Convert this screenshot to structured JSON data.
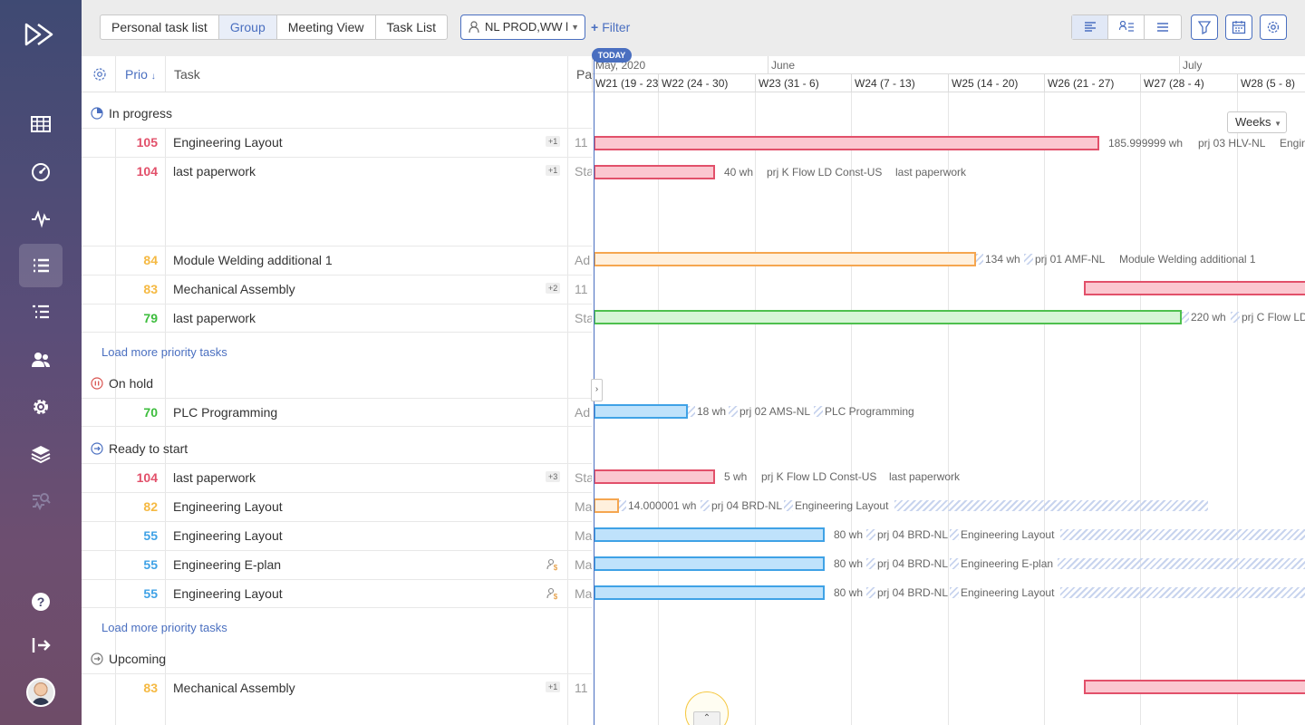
{
  "nav": {
    "items": [
      "dashboard",
      "overview",
      "activity",
      "task-list",
      "hierarchy",
      "users",
      "settings",
      "layers",
      "analytics",
      "help",
      "logout"
    ]
  },
  "toolbar": {
    "view_tabs": [
      "Personal task list",
      "Group",
      "Meeting View",
      "Task List"
    ],
    "active_view": "Group",
    "group_value": "NL PROD,WW l",
    "filter_label": "Filter"
  },
  "table": {
    "col_prio": "Prio",
    "col_task": "Task",
    "col_pa": "Pa",
    "load_more": "Load more priority tasks",
    "groups": [
      {
        "name": "In progress",
        "rows": [
          {
            "prio": "105",
            "color": "#e2506a",
            "task": "Engineering Layout",
            "badge": "+1",
            "pa": "11"
          },
          {
            "prio": "104",
            "color": "#e2506a",
            "task": "last paperwork",
            "badge": "+1",
            "pa": "Sta"
          },
          {
            "prio": "84",
            "color": "#f5b942",
            "task": "Module Welding additional 1",
            "badge": "",
            "pa": "Ad"
          },
          {
            "prio": "83",
            "color": "#f5b942",
            "task": "Mechanical Assembly",
            "badge": "+2",
            "pa": "11"
          },
          {
            "prio": "79",
            "color": "#3dbd3d",
            "task": "last paperwork",
            "badge": "",
            "pa": "Sta"
          }
        ]
      },
      {
        "name": "On hold",
        "rows": [
          {
            "prio": "70",
            "color": "#3dbd3d",
            "task": "PLC Programming",
            "badge": "",
            "pa": "Ad"
          }
        ]
      },
      {
        "name": "Ready to start",
        "rows": [
          {
            "prio": "104",
            "color": "#e2506a",
            "task": "last paperwork",
            "badge": "+3",
            "pa": "Sta"
          },
          {
            "prio": "82",
            "color": "#f5b942",
            "task": "Engineering Layout",
            "badge": "",
            "pa": "Ma"
          },
          {
            "prio": "55",
            "color": "#3fa2e6",
            "task": "Engineering Layout",
            "badge": "",
            "pa": "Ma"
          },
          {
            "prio": "55",
            "color": "#3fa2e6",
            "task": "Engineering E-plan",
            "badge": "",
            "pa": "Ma"
          },
          {
            "prio": "55",
            "color": "#3fa2e6",
            "task": "Engineering Layout",
            "badge": "",
            "pa": "Ma"
          }
        ]
      },
      {
        "name": "Upcoming",
        "rows": [
          {
            "prio": "83",
            "color": "#f5b942",
            "task": "Mechanical Assembly",
            "badge": "+1",
            "pa": "11"
          }
        ]
      }
    ]
  },
  "gantt": {
    "today": "TODAY",
    "zoom": "Weeks",
    "months": [
      "May, 2020",
      "June",
      "July"
    ],
    "weeks": [
      "W21 (19 - 23",
      "W22 (24 - 30)",
      "W23 (31 - 6)",
      "W24 (7 - 13)",
      "W25 (14 - 20)",
      "W26 (21 - 27)",
      "W27 (28 - 4)",
      "W28 (5 - 8)"
    ],
    "bar_labels": {
      "r1": "185.999999 wh",
      "r1b": "prj 03 HLV-NL",
      "r1c": "Engin",
      "r2": "40 wh",
      "r2b": "prj K Flow LD Const-US",
      "r2c": "last paperwork",
      "r3": "134 wh",
      "r3b": "prj 01 AMF-NL",
      "r3c": "Module Welding additional 1",
      "r5": "220 wh",
      "r5b": "prj C Flow LD",
      "r6": "18 wh",
      "r6b": "prj 02 AMS-NL",
      "r6c": "PLC Programming",
      "r7": "5 wh",
      "r7b": "prj K Flow LD Const-US",
      "r7c": "last paperwork",
      "r8": "14.000001 wh",
      "r8b": "prj 04 BRD-NL",
      "r8c": "Engineering Layout",
      "r9": "80 wh",
      "r9b": "prj 04 BRD-NL",
      "r9c": "Engineering Layout",
      "r10": "80 wh",
      "r10b": "prj 04 BRD-NL",
      "r10c": "Engineering E-plan",
      "r11": "80 wh",
      "r11b": "prj 04 BRD-NL",
      "r11c": "Engineering Layout"
    }
  }
}
